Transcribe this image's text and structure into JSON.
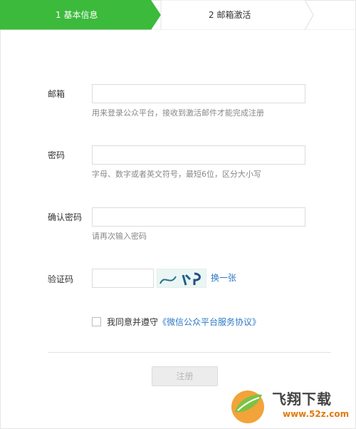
{
  "steps": [
    {
      "label": "1 基本信息",
      "active": true
    },
    {
      "label": "2 邮箱激活",
      "active": false
    }
  ],
  "form": {
    "email": {
      "label": "邮箱",
      "value": "",
      "hint": "用来登录公众平台，接收到激活邮件才能完成注册"
    },
    "password": {
      "label": "密码",
      "value": "",
      "hint": "字母、数字或者英文符号，最短6位，区分大小写"
    },
    "confirm": {
      "label": "确认密码",
      "value": "",
      "hint": "请再次输入密码"
    },
    "captcha": {
      "label": "验证码",
      "value": "",
      "image_text": "wkP",
      "refresh_label": "换一张"
    },
    "agreement": {
      "prefix": "我同意并遵守",
      "link": "《微信公众平台服务协议》",
      "checked": false
    },
    "register_label": "注册"
  },
  "watermark": {
    "brand": "飞翔下载",
    "url": "www.52z.com"
  },
  "colors": {
    "step_active": "#3cba3c",
    "link": "#2e78c7",
    "button_disabled": "#ececec"
  }
}
